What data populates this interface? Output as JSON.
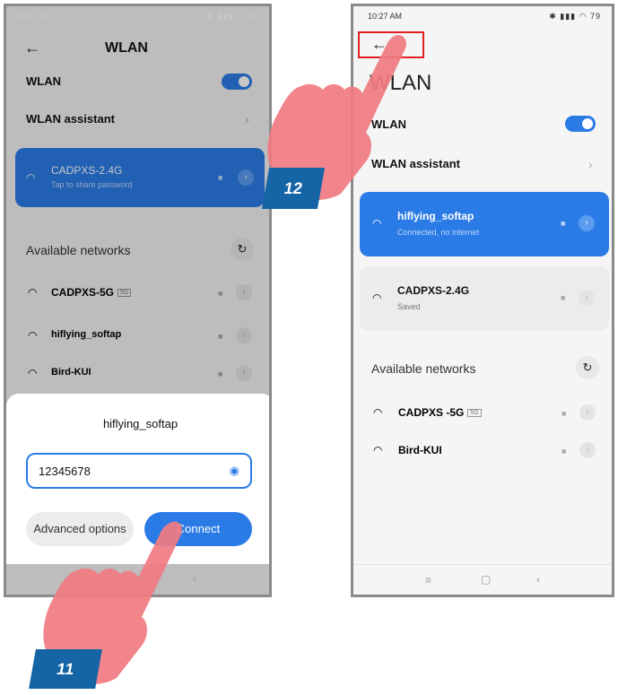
{
  "left": {
    "status_time": "10:12 AM",
    "status_icons": "✱ ▮▮▮ ◠ 80",
    "title": "WLAN",
    "wlan_label": "WLAN",
    "assistant_label": "WLAN assistant",
    "current_network": {
      "name": "CADPXS-2.4G",
      "sub": "Tap to share password"
    },
    "available_title": "Available networks",
    "networks": [
      {
        "name": "CADPXS-5G",
        "badge": "5G"
      },
      {
        "name": "hiflying_softap",
        "badge": ""
      },
      {
        "name": "Bird-KUI",
        "badge": ""
      }
    ],
    "dialog": {
      "title": "hiflying_softap",
      "password": "12345678",
      "advanced_label": "Advanced options",
      "connect_label": "Connect"
    },
    "step_tag": "11"
  },
  "right": {
    "status_time": "10:27 AM",
    "status_icons": "✱ ▮▮▮ ◠ 79",
    "title": "WLAN",
    "wlan_label": "WLAN",
    "assistant_label": "WLAN assistant",
    "connected_network": {
      "name": "hiflying_softap",
      "sub": "Connected, no internet"
    },
    "saved_network": {
      "name": "CADPXS-2.4G",
      "sub": "Saved"
    },
    "available_title": "Available networks",
    "networks": [
      {
        "name": "CADPXS -5G",
        "badge": "5G"
      },
      {
        "name": "Bird-KUI",
        "badge": ""
      }
    ],
    "step_tag": "12"
  },
  "colors": {
    "accent": "#2b7be6",
    "tag": "#1565a6",
    "hand": "#f17b82",
    "highlight": "#e02020"
  }
}
